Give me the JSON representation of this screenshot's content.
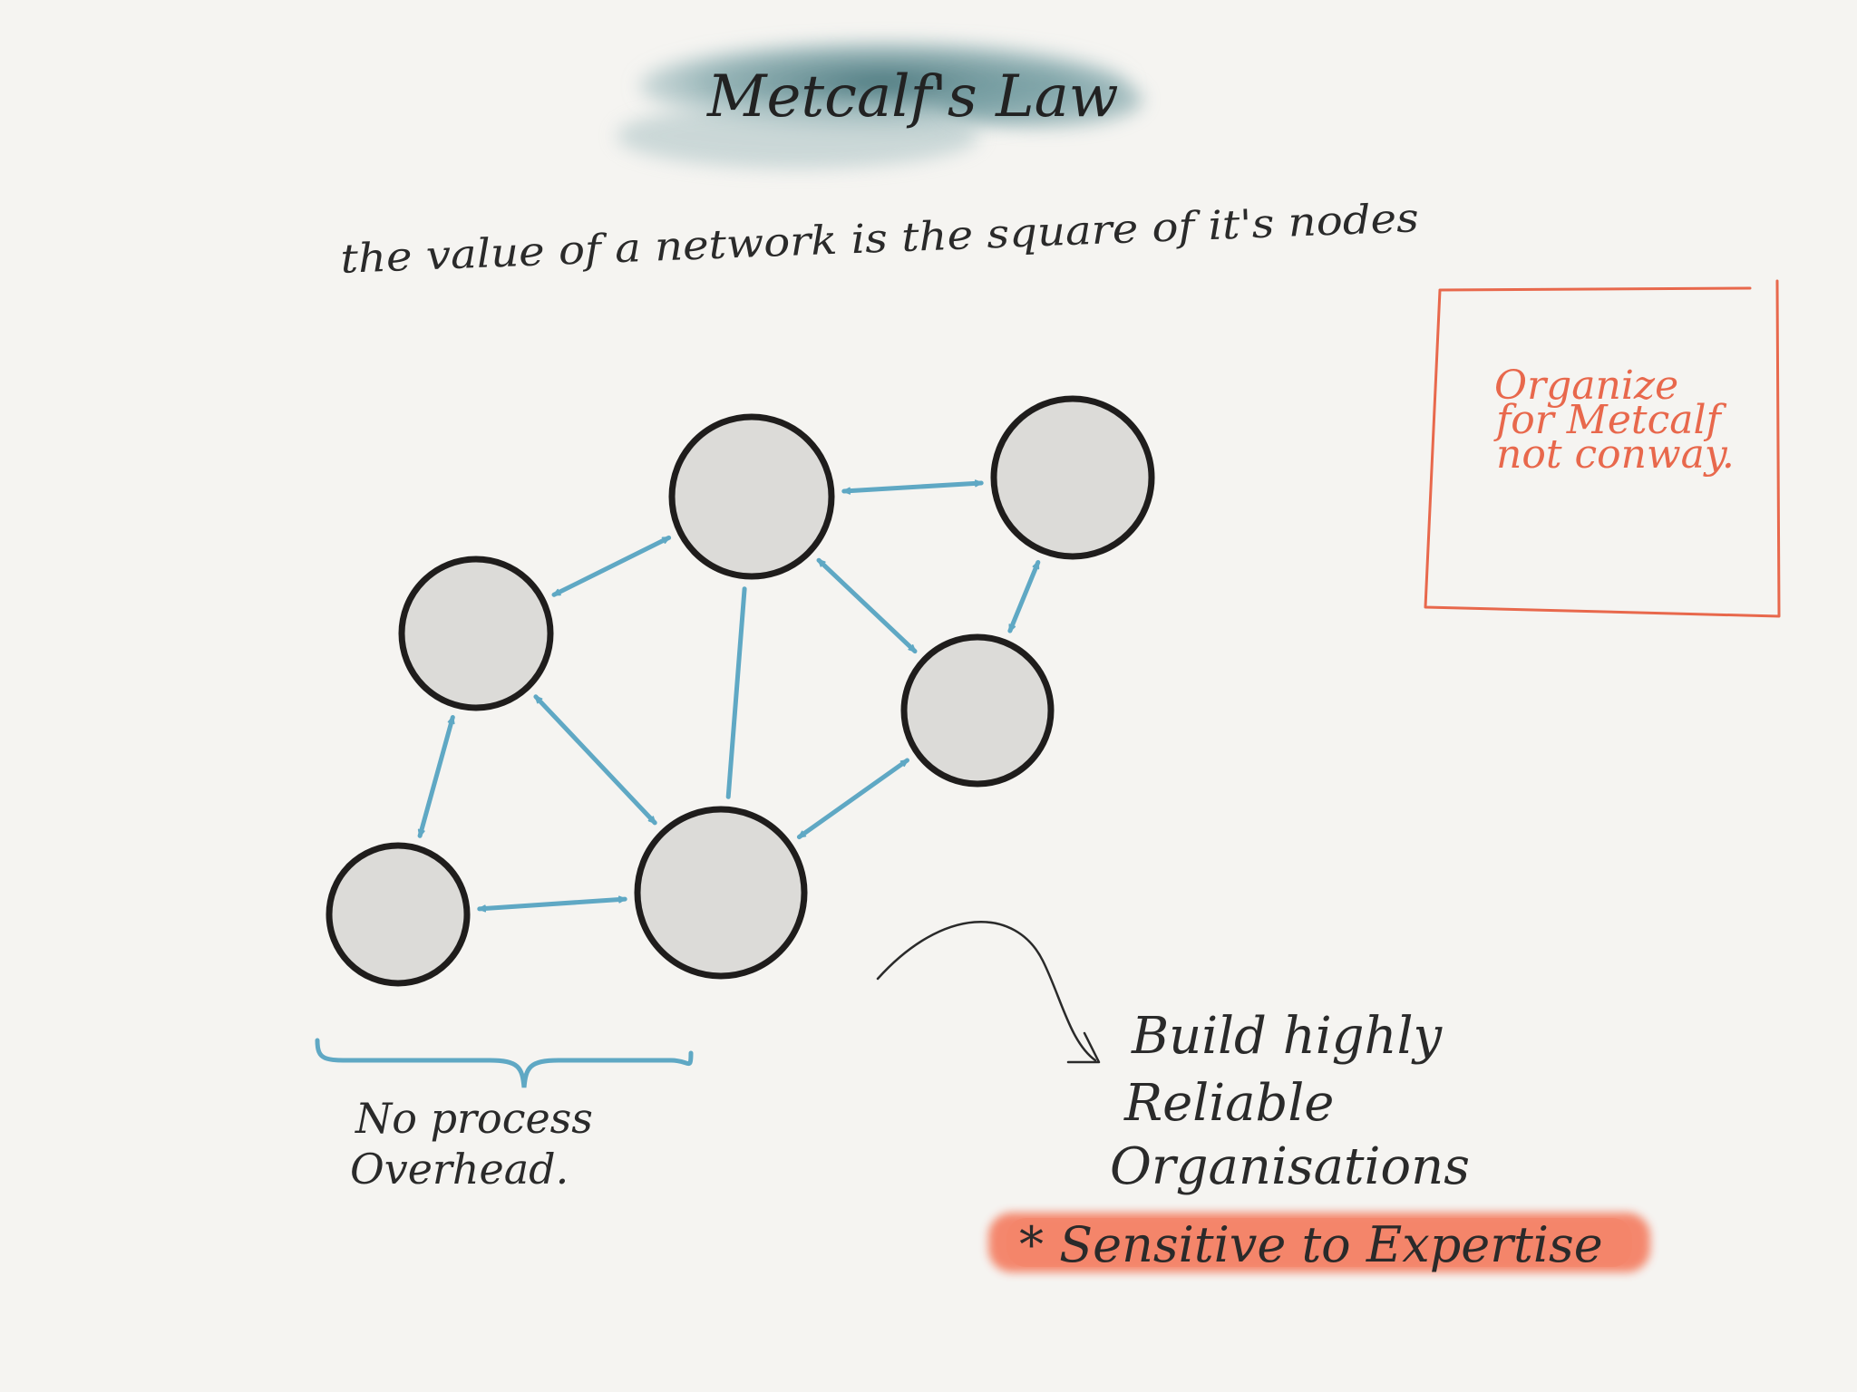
{
  "title": "Metcalf's Law",
  "subtitle": "the value of a network is the square of it's nodes",
  "note": {
    "lines": [
      "Organize",
      "for Metcalf",
      "not conway."
    ]
  },
  "brace_label": {
    "lines": [
      "No process",
      "Overhead."
    ]
  },
  "outcome": {
    "lines": [
      "Build highly",
      "Reliable",
      "Organisations"
    ]
  },
  "highlight": "* Sensitive to Expertise",
  "colors": {
    "title_wash": "#4a7b82",
    "arrow": "#5fa8c4",
    "node_fill": "#dcdbd8",
    "node_stroke": "#1f1d1c",
    "note": "#e8684c",
    "highlight": "#f47b5e",
    "ink": "#2a2a2a"
  },
  "network": {
    "nodes": [
      {
        "id": "top"
      },
      {
        "id": "top-right"
      },
      {
        "id": "left"
      },
      {
        "id": "right"
      },
      {
        "id": "bottom"
      },
      {
        "id": "bottom-left"
      }
    ],
    "edges": [
      {
        "from": "left",
        "to": "top",
        "type": "double-arrow"
      },
      {
        "from": "top",
        "to": "top-right",
        "type": "double-arrow"
      },
      {
        "from": "top",
        "to": "right",
        "type": "double-arrow"
      },
      {
        "from": "top-right",
        "to": "right",
        "type": "double-arrow"
      },
      {
        "from": "top",
        "to": "bottom",
        "type": "line"
      },
      {
        "from": "left",
        "to": "bottom",
        "type": "double-arrow"
      },
      {
        "from": "left",
        "to": "bottom-left",
        "type": "double-arrow"
      },
      {
        "from": "bottom-left",
        "to": "bottom",
        "type": "double-arrow"
      },
      {
        "from": "right",
        "to": "bottom",
        "type": "double-arrow"
      }
    ]
  }
}
